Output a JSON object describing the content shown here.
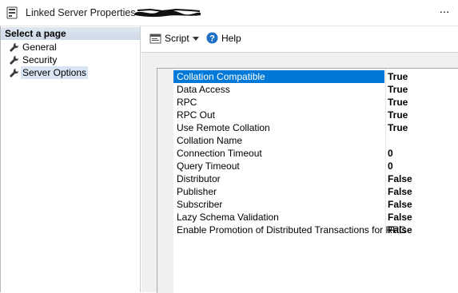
{
  "window": {
    "title": "Linked Server Properties - ",
    "more_label": "..."
  },
  "left_pane": {
    "header": "Select a page",
    "pages": [
      {
        "label": "General"
      },
      {
        "label": "Security"
      },
      {
        "label": "Server Options",
        "selected": true
      }
    ]
  },
  "toolbar": {
    "script_label": "Script",
    "help_label": "Help"
  },
  "properties": [
    {
      "name": "Collation Compatible",
      "value": "True",
      "selected": true
    },
    {
      "name": "Data Access",
      "value": "True"
    },
    {
      "name": "RPC",
      "value": "True"
    },
    {
      "name": "RPC Out",
      "value": "True"
    },
    {
      "name": "Use Remote Collation",
      "value": "True"
    },
    {
      "name": "Collation Name",
      "value": ""
    },
    {
      "name": "Connection Timeout",
      "value": "0"
    },
    {
      "name": "Query Timeout",
      "value": "0"
    },
    {
      "name": "Distributor",
      "value": "False"
    },
    {
      "name": "Publisher",
      "value": "False"
    },
    {
      "name": "Subscriber",
      "value": "False"
    },
    {
      "name": "Lazy Schema Validation",
      "value": "False"
    },
    {
      "name": "Enable Promotion of Distributed Transactions for RPC",
      "value": "False"
    }
  ],
  "colors": {
    "selection": "#0078d7",
    "header_band": "#dfe6ef",
    "content_bg": "#f0f0f0"
  }
}
